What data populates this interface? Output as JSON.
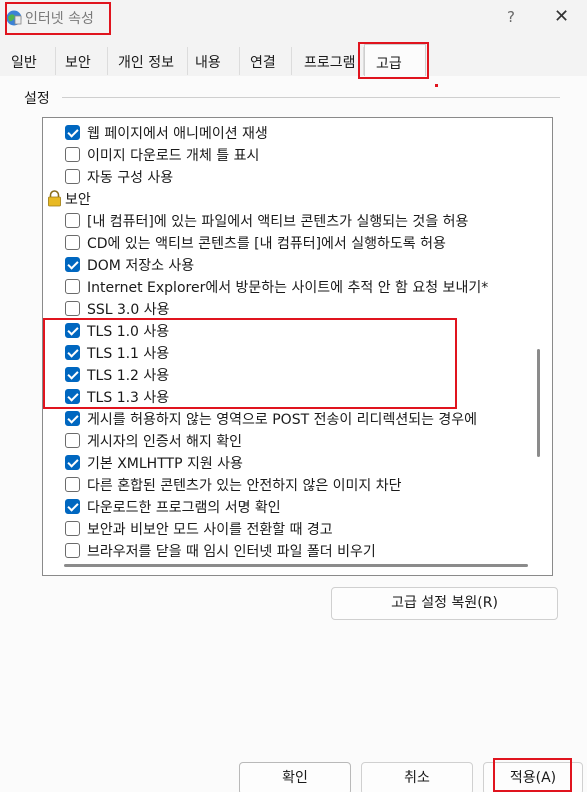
{
  "window": {
    "title": "인터넷 속성",
    "help_glyph": "?",
    "close_glyph": "✕"
  },
  "tabs": [
    {
      "label": "일반"
    },
    {
      "label": "보안"
    },
    {
      "label": "개인 정보"
    },
    {
      "label": "내용"
    },
    {
      "label": "연결"
    },
    {
      "label": "프로그램"
    },
    {
      "label": "고급",
      "active": true
    }
  ],
  "settings": {
    "group_label": "설정",
    "items": [
      {
        "label": "웹 페이지에서 애니메이션 재생",
        "checked": true
      },
      {
        "label": "이미지 다운로드 개체 틀 표시",
        "checked": false
      },
      {
        "label": "자동 구성 사용",
        "checked": false
      },
      {
        "label": "보안",
        "category": true,
        "icon": "lock-icon"
      },
      {
        "label": "[내 컴퓨터]에 있는 파일에서 액티브 콘텐츠가 실행되는 것을 허용",
        "checked": false
      },
      {
        "label": "CD에 있는 액티브 콘텐츠를 [내 컴퓨터]에서 실행하도록 허용",
        "checked": false
      },
      {
        "label": "DOM 저장소 사용",
        "checked": true
      },
      {
        "label": "Internet Explorer에서 방문하는 사이트에 추적 안 함 요청 보내기*",
        "checked": false
      },
      {
        "label": "SSL 3.0 사용",
        "checked": false
      },
      {
        "label": "TLS 1.0 사용",
        "checked": true
      },
      {
        "label": "TLS 1.1 사용",
        "checked": true
      },
      {
        "label": "TLS 1.2 사용",
        "checked": true
      },
      {
        "label": "TLS 1.3 사용",
        "checked": true
      },
      {
        "label": "게시를 허용하지 않는 영역으로 POST 전송이 리디렉션되는 경우에",
        "checked": true
      },
      {
        "label": "게시자의 인증서 해지 확인",
        "checked": false
      },
      {
        "label": "기본 XMLHTTP 지원 사용",
        "checked": true
      },
      {
        "label": "다른 혼합된 콘텐츠가 있는 안전하지 않은 이미지 차단",
        "checked": false
      },
      {
        "label": "다운로드한 프로그램의 서명 확인",
        "checked": true
      },
      {
        "label": "보안과 비보안 모드 사이를 전환할 때 경고",
        "checked": false
      },
      {
        "label": "브라우저를 닫을 때 임시 인터넷 파일 폴더 비우기",
        "checked": false
      }
    ]
  },
  "buttons": {
    "restore": "고급 설정 복원(R)",
    "ok": "확인",
    "cancel": "취소",
    "apply": "적용(A)"
  },
  "colors": {
    "accent": "#0067c0",
    "highlight": "#e0141e"
  }
}
